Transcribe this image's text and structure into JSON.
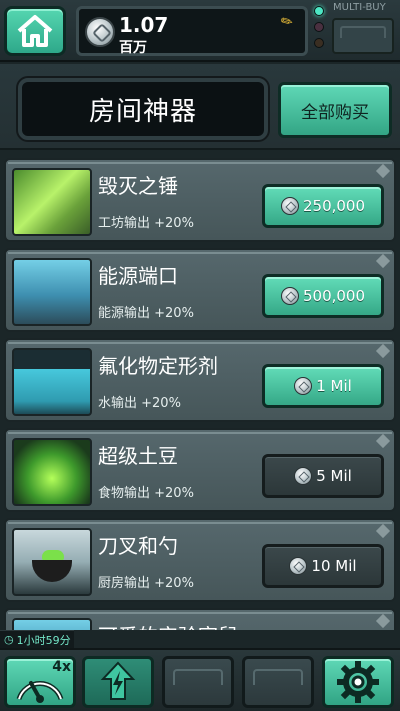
{
  "currency": {
    "value": "1.07",
    "unit": "百万"
  },
  "multibuy_label": "MULTI-BUY",
  "header": {
    "title": "房间神器",
    "buy_all": "全部购买"
  },
  "items": [
    {
      "name": "毁灭之锤",
      "bonus": "工坊输出 +20%",
      "price": "250,000",
      "affordable": true
    },
    {
      "name": "能源端口",
      "bonus": "能源输出 +20%",
      "price": "500,000",
      "affordable": true
    },
    {
      "name": "氟化物定形剂",
      "bonus": "水输出 +20%",
      "price": "1 Mil",
      "affordable": true
    },
    {
      "name": "超级土豆",
      "bonus": "食物输出 +20%",
      "price": "5 Mil",
      "affordable": false
    },
    {
      "name": "刀叉和勺",
      "bonus": "厨房输出 +20%",
      "price": "10 Mil",
      "affordable": false
    },
    {
      "name": "可爱的实验室鼠"
    }
  ],
  "timer": "1小时59分",
  "boost_badge": "4x",
  "colors": {
    "accent_teal": "#4fcfa9",
    "panel": "#4f6165",
    "dark": "#0b1113"
  }
}
